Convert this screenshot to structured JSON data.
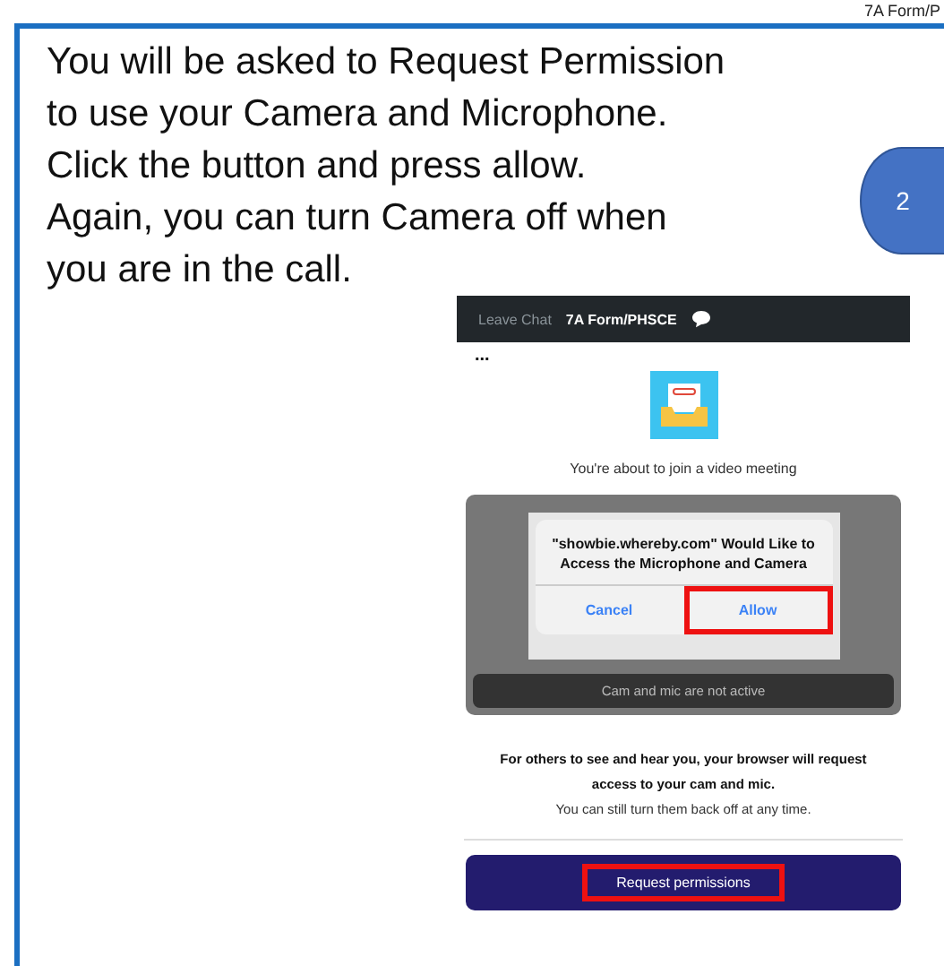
{
  "header_snippet": "7A Form/P",
  "instruction": {
    "text": "You will be asked to Request Permission\nto use your Camera and Microphone.\nClick the button and press allow.\nAgain, you can turn Camera off when\nyou are in the call.",
    "step": "2"
  },
  "screenshot": {
    "top_bar": {
      "leave": "Leave Chat",
      "title": "7A Form/PHSCE"
    },
    "menu": "...",
    "prompt": "You're about to join a video meeting",
    "dialog": {
      "message": "\"showbie.whereby.com\" Would Like to Access the Microphone and Camera",
      "buttons": [
        {
          "label": "Cancel",
          "highlighted": false
        },
        {
          "label": "Allow",
          "highlighted": true
        }
      ]
    },
    "status": "Cam and mic are not active",
    "explanation": "For others to see and hear you, your browser will request access to your cam and mic.",
    "note": "You can still turn them back off at any time.",
    "button": {
      "label": "Request permissions",
      "highlighted": true
    }
  }
}
